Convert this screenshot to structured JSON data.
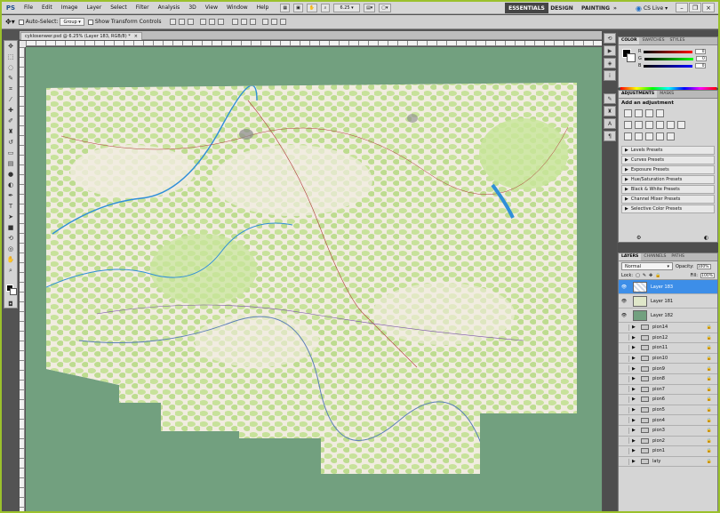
{
  "app": {
    "logo": "PS",
    "menu": [
      "File",
      "Edit",
      "Image",
      "Layer",
      "Select",
      "Filter",
      "Analysis",
      "3D",
      "View",
      "Window",
      "Help"
    ],
    "zoom": "6.25",
    "workspaces": [
      "ESSENTIALS",
      "DESIGN",
      "PAINTING"
    ],
    "cslive": "CS Live"
  },
  "options": {
    "auto_select_label": "Auto-Select:",
    "auto_select_value": "Group",
    "transform_label": "Show Transform Controls"
  },
  "document": {
    "tab_title": "cyklosenwer.psd @ 6.25% (Layer 183, RGB/8) *"
  },
  "panels": {
    "color_tabs": [
      "COLOR",
      "SWATCHES",
      "STYLES"
    ],
    "color_channels": [
      {
        "label": "R",
        "value": "0"
      },
      {
        "label": "G",
        "value": "0"
      },
      {
        "label": "B",
        "value": "0"
      }
    ],
    "adj_tabs": [
      "ADJUSTMENTS",
      "MASKS"
    ],
    "adj_title": "Add an adjustment",
    "presets": [
      "Levels Presets",
      "Curves Presets",
      "Exposure Presets",
      "Hue/Saturation Presets",
      "Black & White Presets",
      "Channel Mixer Presets",
      "Selective Color Presets"
    ],
    "layer_tabs": [
      "LAYERS",
      "CHANNELS",
      "PATHS"
    ],
    "blend_mode": "Normal",
    "opacity_label": "Opacity:",
    "opacity": "100%",
    "lock_label": "Lock:",
    "fill_label": "Fill:",
    "fill": "100%",
    "layers": [
      {
        "name": "Layer 183",
        "type": "layer",
        "selected": true
      },
      {
        "name": "Layer 181",
        "type": "layer",
        "selected": false
      },
      {
        "name": "Layer 182",
        "type": "layer",
        "selected": false
      }
    ],
    "groups": [
      "pion14",
      "pion12",
      "pion11",
      "pion10",
      "pion9",
      "pion8",
      "pion7",
      "pion6",
      "pion5",
      "pion4",
      "pion3",
      "pion2",
      "pion1",
      "laty"
    ]
  },
  "colors": {
    "canvas_bg": "#72a07f",
    "map_base": "#f1ece0",
    "forest": "#bfe08e",
    "water": "#2f8fd8",
    "selection": "#3d8ee8",
    "frame": "#9bc12c"
  }
}
